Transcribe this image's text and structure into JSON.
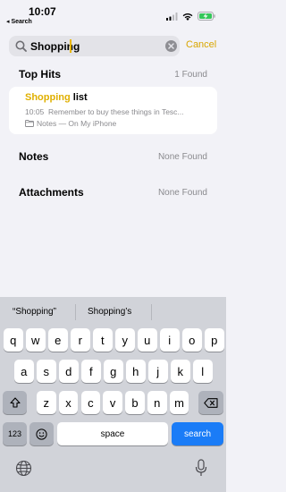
{
  "status_bar": {
    "time": "10:07",
    "back_label": "◂ Search"
  },
  "search": {
    "query": "Shopping",
    "cancel_label": "Cancel"
  },
  "top_hits": {
    "title": "Top Hits",
    "count": "1 Found",
    "result": {
      "title_highlight": "Shopping",
      "title_rest": " list",
      "time": "10:05",
      "snippet": "Remember to buy these things in Tesc...",
      "location": "Notes — On My iPhone"
    }
  },
  "notes": {
    "title": "Notes",
    "count": "None Found"
  },
  "attachments": {
    "title": "Attachments",
    "count": "None Found"
  },
  "keyboard": {
    "suggestions": [
      "“Shopping”",
      "Shopping’s"
    ],
    "row1": [
      "q",
      "w",
      "e",
      "r",
      "t",
      "y",
      "u",
      "i",
      "o",
      "p"
    ],
    "row2": [
      "a",
      "s",
      "d",
      "f",
      "g",
      "h",
      "j",
      "k",
      "l"
    ],
    "row3": [
      "z",
      "x",
      "c",
      "v",
      "b",
      "n",
      "m"
    ],
    "numbers_label": "123",
    "space_label": "space",
    "search_label": "search",
    "accent_color": "#1a7cf7"
  },
  "icons": [
    "search-icon",
    "clear-icon",
    "signal-icon",
    "wifi-icon",
    "battery-charging-icon",
    "folder-icon",
    "shift-icon",
    "delete-icon",
    "emoji-icon",
    "globe-icon",
    "microphone-icon"
  ]
}
